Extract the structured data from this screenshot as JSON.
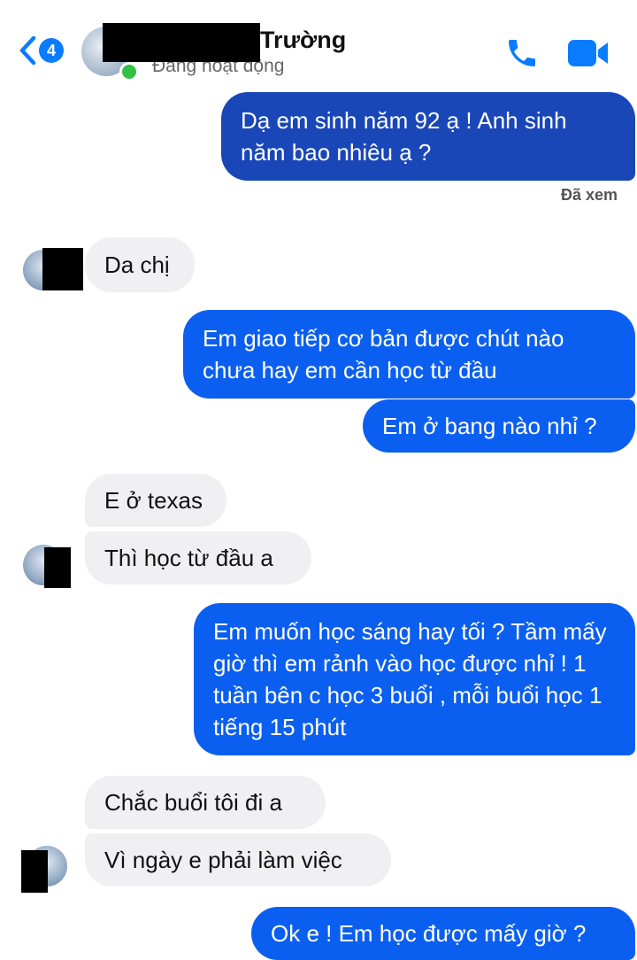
{
  "header": {
    "back_badge": "4",
    "contact_name": "Trường",
    "status": "Đang hoạt động"
  },
  "messages": [
    {
      "from": "me",
      "text": "Dạ em sinh năm 92 ạ ! Anh sinh năm bao nhiêu ạ ?"
    },
    {
      "from": "them",
      "text": "Da chị"
    },
    {
      "from": "me",
      "text": "Em giao tiếp cơ bản được chút nào chưa hay em cần học từ đầu"
    },
    {
      "from": "me",
      "text": "Em ở bang nào nhỉ ?"
    },
    {
      "from": "them",
      "text": "E ở texas"
    },
    {
      "from": "them",
      "text": "Thì học từ đầu a"
    },
    {
      "from": "me",
      "text": "Em muốn học sáng hay tối ? Tầm mấy giờ thì em rảnh vào học được nhỉ ! 1 tuần bên c học 3 buổi , mỗi buổi học 1 tiếng 15 phút"
    },
    {
      "from": "them",
      "text": "Chắc buổi tôi đi a"
    },
    {
      "from": "them",
      "text": "Vì ngày e phải làm việc"
    },
    {
      "from": "me",
      "text": "Ok e ! Em học được mấy giờ ?"
    }
  ],
  "seen_label": "Đã xem",
  "colors": {
    "accent": "#0a7cff",
    "outgoing": "#0b5ff0",
    "outgoing_dark": "#1a47b8",
    "incoming": "#f0f0f2"
  },
  "icons": [
    "chevron-left-icon",
    "phone-icon",
    "video-camera-icon"
  ]
}
